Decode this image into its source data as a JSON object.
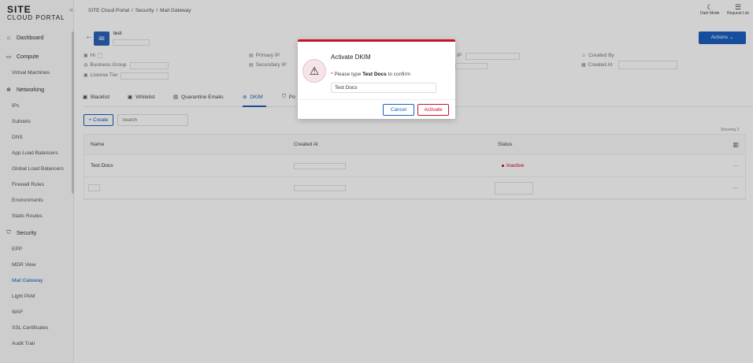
{
  "app": {
    "logo_line1": "SITE",
    "logo_line2": "CLOUD PORTAL",
    "collapse_glyph": "«"
  },
  "breadcrumb": [
    "SITE Cloud Portal",
    "/",
    "Security",
    "/",
    "Mail Gateway"
  ],
  "topbar": {
    "dark_mode": "Dark Mode",
    "request_list": "Request List"
  },
  "sidebar": {
    "groups": [
      {
        "label": "Dashboard",
        "icon": "dashboard-icon",
        "items": []
      },
      {
        "label": "Compute",
        "icon": "monitor-icon",
        "items": [
          "Virtual Machines"
        ]
      },
      {
        "label": "Networking",
        "icon": "globe-icon",
        "items": [
          "IPs",
          "Subnets",
          "DNS",
          "App Load Balancers",
          "Global Load Balancers",
          "Firewall Rules",
          "Environments",
          "Static Routes"
        ]
      },
      {
        "label": "Security",
        "icon": "shield-icon",
        "items": [
          "EPP",
          "MDR View",
          "Mail Gateway",
          "Light PAM",
          "WAF",
          "SSL Certificates",
          "Audit Trail"
        ]
      }
    ],
    "active_item": "Mail Gateway"
  },
  "entity": {
    "name": "test"
  },
  "meta": {
    "hi_label": "Hi",
    "business_group_label": "Business Group",
    "license_tier_label": "License Tier",
    "primary_ip_label": "Primary IP",
    "secondary_ip_label": "Secondary IP",
    "ip_label": "IP",
    "created_by_label": "Created By",
    "created_at_label": "Created At"
  },
  "actions_label": "Actions ⌄",
  "tabs": [
    {
      "label": "Blacklist",
      "icon": "list-icon"
    },
    {
      "label": "Whitelist",
      "icon": "list-icon"
    },
    {
      "label": "Quarantine Emails",
      "icon": "mail-icon"
    },
    {
      "label": "DKIM",
      "icon": "key-icon"
    },
    {
      "label": "Po",
      "icon": "shield-icon"
    }
  ],
  "active_tab": "DKIM",
  "toolbar": {
    "create_label": "+ Create",
    "search_placeholder": "Search"
  },
  "showing_label": "Showing 2",
  "table": {
    "columns": [
      "Name",
      "Created At",
      "Status"
    ],
    "rows": [
      {
        "name": "Test Docs",
        "status": "Inactive"
      },
      {
        "name": "",
        "status": ""
      }
    ],
    "more_glyph": "···",
    "columns_glyph": "▥"
  },
  "modal": {
    "title": "Activate DKIM",
    "prompt_required": "* ",
    "prompt_prefix": "Please type ",
    "prompt_bold": "Test Docs",
    "prompt_suffix": " to confirm",
    "input_value": "Test Docs",
    "cancel_label": "Cancel",
    "activate_label": "Activate"
  },
  "colors": {
    "accent": "#1c5fbf",
    "danger": "#c8102e"
  }
}
